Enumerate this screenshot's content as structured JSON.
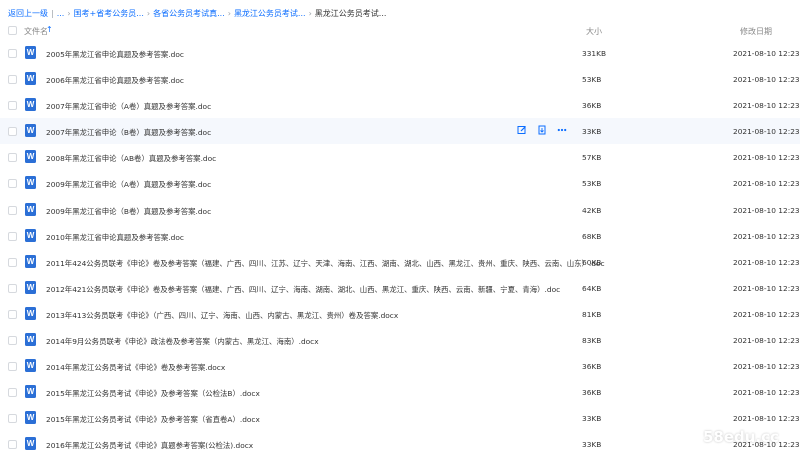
{
  "breadcrumb": {
    "back": "返回上一级",
    "items": [
      "...",
      "国考+省考公务员...",
      "各省公务员考试真...",
      "黑龙江公务员考试..."
    ],
    "current": "黑龙江公务员考试..."
  },
  "columns": {
    "name": "文件名",
    "size": "大小",
    "modified": "修改日期"
  },
  "files": [
    {
      "name": "2005年黑龙江省申论真题及参考答案.doc",
      "size": "331KB",
      "date": "2021-08-10 12:23"
    },
    {
      "name": "2006年黑龙江省申论真题及参考答案.doc",
      "size": "53KB",
      "date": "2021-08-10 12:23"
    },
    {
      "name": "2007年黑龙江省申论（A卷）真题及参考答案.doc",
      "size": "36KB",
      "date": "2021-08-10 12:23"
    },
    {
      "name": "2007年黑龙江省申论（B卷）真题及参考答案.doc",
      "size": "33KB",
      "date": "2021-08-10 12:23"
    },
    {
      "name": "2008年黑龙江省申论（AB卷）真题及参考答案.doc",
      "size": "57KB",
      "date": "2021-08-10 12:23"
    },
    {
      "name": "2009年黑龙江省申论（A卷）真题及参考答案.doc",
      "size": "53KB",
      "date": "2021-08-10 12:23"
    },
    {
      "name": "2009年黑龙江省申论（B卷）真题及参考答案.doc",
      "size": "42KB",
      "date": "2021-08-10 12:23"
    },
    {
      "name": "2010年黑龙江省申论真题及参考答案.doc",
      "size": "68KB",
      "date": "2021-08-10 12:23"
    },
    {
      "name": "2011年424公务员联考《申论》卷及参考答案（福建、广西、四川、江苏、辽宁、天津、海南、江西、湖南、湖北、山西、黑龙江、贵州、重庆、陕西、云南、山东）.doc",
      "size": "60KB",
      "date": "2021-08-10 12:23"
    },
    {
      "name": "2012年421公务员联考《申论》卷及参考答案（福建、广西、四川、辽宁、海南、湖南、湖北、山西、黑龙江、重庆、陕西、云南、新疆、宁夏、青海）.doc",
      "size": "64KB",
      "date": "2021-08-10 12:23"
    },
    {
      "name": "2013年413公务员联考《申论》（广西、四川、辽宁、海南、山西、内蒙古、黑龙江、贵州）卷及答案.docx",
      "size": "81KB",
      "date": "2021-08-10 12:23"
    },
    {
      "name": "2014年9月公务员联考《申论》政法卷及参考答案（内蒙古、黑龙江、海南）.docx",
      "size": "83KB",
      "date": "2021-08-10 12:23"
    },
    {
      "name": "2014年黑龙江公务员考试《申论》卷及参考答案.docx",
      "size": "36KB",
      "date": "2021-08-10 12:23"
    },
    {
      "name": "2015年黑龙江公务员考试《申论》及参考答案（公检法B）.docx",
      "size": "36KB",
      "date": "2021-08-10 12:23"
    },
    {
      "name": "2015年黑龙江公务员考试《申论》及参考答案（省直卷A）.docx",
      "size": "33KB",
      "date": "2021-08-10 12:23"
    },
    {
      "name": "2016年黑龙江公务员考试《申论》真题参考答案(公检法).docx",
      "size": "33KB",
      "date": "2021-08-10 12:23"
    }
  ],
  "file_icon_letter": "W",
  "watermark": "58edu.cc",
  "colors": {
    "accent": "#0b6dff",
    "word_icon": "#2b6fd6",
    "hover_row": "#f5f8fd"
  }
}
